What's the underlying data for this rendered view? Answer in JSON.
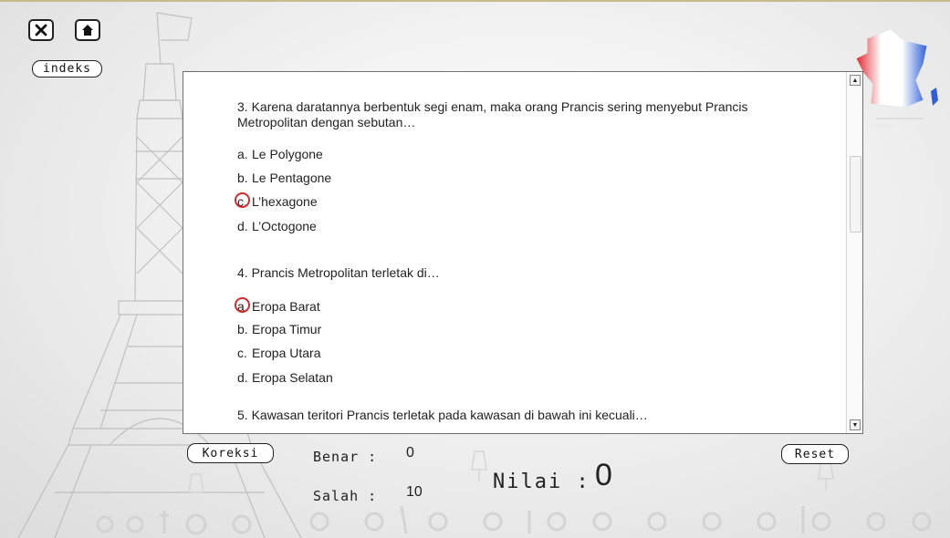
{
  "toolbar": {
    "close_icon": "close-icon",
    "home_icon": "home-icon",
    "index_label": "indeks"
  },
  "quiz": {
    "questions": [
      {
        "text": "3. Karena daratannya berbentuk segi enam, maka orang Prancis sering menyebut Prancis Metropolitan dengan sebutan…",
        "options": [
          {
            "letter": "a.",
            "text": "Le Polygone",
            "selected": false
          },
          {
            "letter": "b.",
            "text": "Le Pentagone",
            "selected": false
          },
          {
            "letter": "c.",
            "text": "L’hexagone",
            "selected": true
          },
          {
            "letter": "d.",
            "text": "L’Octogone",
            "selected": false
          }
        ]
      },
      {
        "text": "4. Prancis Metropolitan terletak di…",
        "options": [
          {
            "letter": "a.",
            "text": "Eropa Barat",
            "selected": true
          },
          {
            "letter": "b.",
            "text": "Eropa Timur",
            "selected": false
          },
          {
            "letter": "c.",
            "text": "Eropa Utara",
            "selected": false
          },
          {
            "letter": "d.",
            "text": "Eropa Selatan",
            "selected": false
          }
        ]
      },
      {
        "text": "5. Kawasan teritori Prancis terletak pada kawasan di bawah ini kecuali…",
        "options": []
      }
    ]
  },
  "footer": {
    "koreksi_label": "Koreksi",
    "benar_label": "Benar :",
    "benar_value": "0",
    "salah_label": "Salah :",
    "salah_value": "10",
    "nilai_label": "Nilai :",
    "nilai_value": "0",
    "reset_label": "Reset"
  },
  "colors": {
    "selection_ring": "#d22b2b",
    "flag_blue": "#2c5fd8",
    "flag_red": "#e0242b"
  }
}
